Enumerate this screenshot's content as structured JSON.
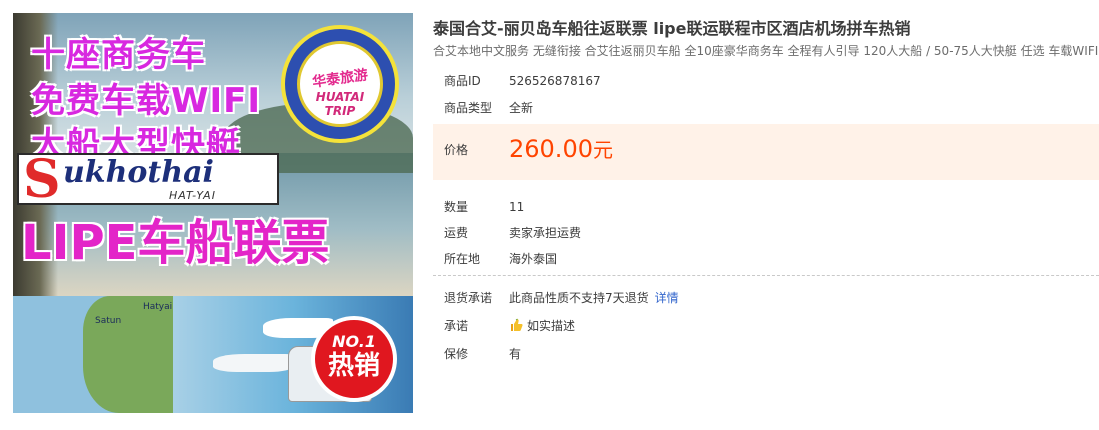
{
  "hero": {
    "promo_lines": [
      "十座商务车",
      "免费车载WIFI",
      "大船大型快艇"
    ],
    "seal_cn": "华泰旅游",
    "seal_en": "HUATAI TRIP",
    "brand_initial": "S",
    "brand_rest": "ukhothai",
    "brand_sub": "HAT-YAI",
    "lipe_banner": "LIPE车船联票",
    "map_labels": [
      "Satun",
      "Hatyai"
    ],
    "badge_top": "NO.1",
    "badge_text": "热销"
  },
  "product": {
    "title": "泰国合艾-丽贝岛车船往返联票 lipe联运联程市区酒店机场拼车热销",
    "subtitle": "合艾本地中文服务 无缝衔接 合艾往返丽贝车船 全10座豪华商务车 全程有人引导 120人大船 / 50-75人大快艇 任选 车载WIFI"
  },
  "details": {
    "id_label": "商品ID",
    "id_value": "526526878167",
    "type_label": "商品类型",
    "type_value": "全新",
    "price_label": "价格",
    "price_value": "260.00",
    "price_unit": "元",
    "qty_label": "数量",
    "qty_value": "11",
    "shipping_label": "运费",
    "shipping_value": "卖家承担运费",
    "location_label": "所在地",
    "location_value": "海外泰国",
    "return_label": "退货承诺",
    "return_value": "此商品性质不支持7天退货",
    "return_link": "详情",
    "promise_label": "承诺",
    "promise_value": "如实描述",
    "warranty_label": "保修",
    "warranty_value": "有"
  },
  "colors": {
    "price": "#ff4400",
    "price_bg": "#fff2e8",
    "link": "#3366cc"
  }
}
